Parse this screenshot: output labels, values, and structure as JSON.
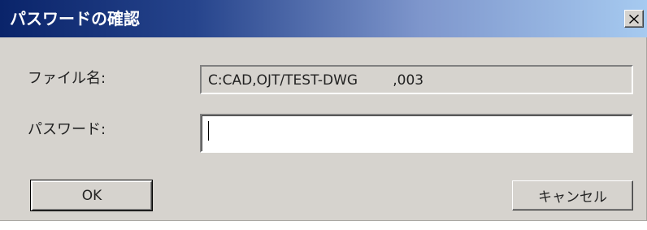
{
  "window": {
    "title": "パスワードの確認",
    "close_icon": "close-icon"
  },
  "form": {
    "filename_label": "ファイル名:",
    "filename_value": "C:CAD,OJT/TEST-DWG        ,003",
    "password_label": "パスワード:",
    "password_value": ""
  },
  "buttons": {
    "ok_label": "OK",
    "cancel_label": "キャンセル"
  },
  "colors": {
    "titlebar_start": "#0a246a",
    "titlebar_end": "#a6caf0",
    "dialog_background": "#d6d3ce"
  }
}
